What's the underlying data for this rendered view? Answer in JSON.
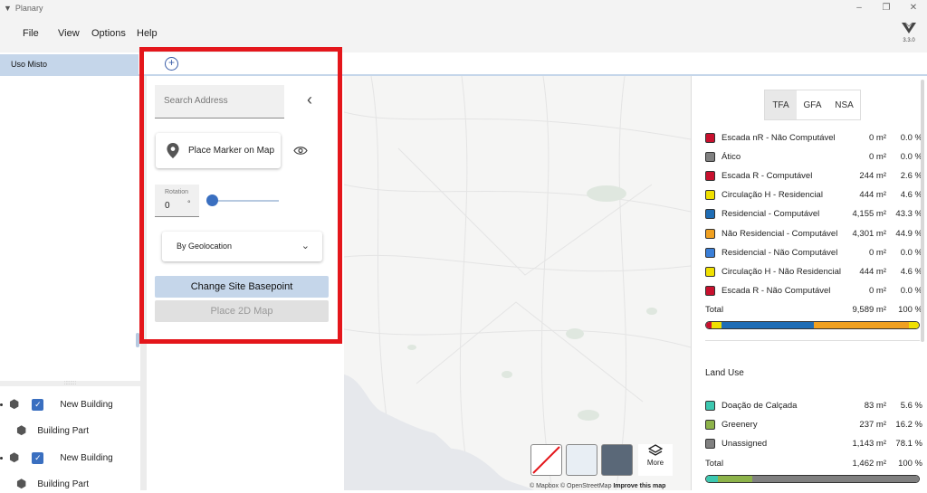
{
  "app": {
    "title": "Planary",
    "version": "3.3.0"
  },
  "menu": [
    "File",
    "View",
    "Options",
    "Help"
  ],
  "tabs": {
    "active": "Uso Misto",
    "add_icon": "plus-circle-icon"
  },
  "tree": [
    {
      "label": "New Building"
    },
    {
      "label": "Building Part"
    },
    {
      "label": "New Building"
    },
    {
      "label": "Building Part"
    }
  ],
  "site": {
    "search_placeholder": "Search Address",
    "marker_label": "Place Marker on Map",
    "rotation_label": "Rotation",
    "rotation_value": "0",
    "rotation_unit": "°",
    "slider_value": 0,
    "geo_mode": "By Geolocation",
    "basepoint_label": "Change Site Basepoint",
    "map2d_label": "Place 2D Map"
  },
  "map": {
    "more_label": "More",
    "attribution": "© Mapbox © OpenStreetMap",
    "improve": "Improve this map"
  },
  "tfa_tabs": [
    "TFA",
    "GFA",
    "NSA"
  ],
  "tfa_rows": [
    {
      "name": "Escada nR - Não Computável",
      "area": "0 m²",
      "pct": "0.0 %",
      "color": "#c8102e"
    },
    {
      "name": "Ático",
      "area": "0 m²",
      "pct": "0.0 %",
      "color": "#808080"
    },
    {
      "name": "Escada R - Computável",
      "area": "244 m²",
      "pct": "2.6 %",
      "color": "#c8102e"
    },
    {
      "name": "Circulação H - Residencial",
      "area": "444 m²",
      "pct": "4.6 %",
      "color": "#f0e000"
    },
    {
      "name": "Residencial - Computável",
      "area": "4,155 m²",
      "pct": "43.3 %",
      "color": "#1f6db5"
    },
    {
      "name": "Não Residencial - Computável",
      "area": "4,301 m²",
      "pct": "44.9 %",
      "color": "#f0a020"
    },
    {
      "name": "Residencial - Não Computável",
      "area": "0 m²",
      "pct": "0.0 %",
      "color": "#3a7fd8"
    },
    {
      "name": "Circulação H - Não Residencial",
      "area": "444 m²",
      "pct": "4.6 %",
      "color": "#f0e000"
    },
    {
      "name": "Escada R - Não Computável",
      "area": "0 m²",
      "pct": "0.0 %",
      "color": "#c8102e"
    }
  ],
  "tfa_total": {
    "label": "Total",
    "area": "9,589 m²",
    "pct": "100 %"
  },
  "land_use_title": "Land Use",
  "land_rows": [
    {
      "name": "Doação de Calçada",
      "area": "83 m²",
      "pct": "5.6 %",
      "color": "#3cc8b0"
    },
    {
      "name": "Greenery",
      "area": "237 m²",
      "pct": "16.2 %",
      "color": "#8db34a"
    },
    {
      "name": "Unassigned",
      "area": "1,143 m²",
      "pct": "78.1 %",
      "color": "#808080"
    }
  ],
  "land_total": {
    "label": "Total",
    "area": "1,462 m²",
    "pct": "100 %"
  }
}
